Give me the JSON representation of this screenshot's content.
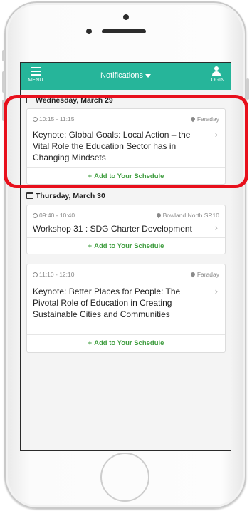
{
  "navbar": {
    "menu_label": "MENU",
    "title": "Notifications",
    "login_label": "LOGIN",
    "background": "#26b59a"
  },
  "days": [
    {
      "date": "Wednesday, March 29",
      "events": [
        {
          "time": "10:15 - 11:15",
          "location": "Faraday",
          "title": "Keynote: Global Goals: Local Action – the Vital Role the Education Sector has in Changing Mindsets",
          "add_label": "Add to Your Schedule"
        }
      ]
    },
    {
      "date": "Thursday, March 30",
      "events": [
        {
          "time": "09:40 - 10:40",
          "location": "Bowland North SR10",
          "title": "Workshop 31 : SDG Charter Development",
          "add_label": "Add to Your Schedule"
        },
        {
          "time": "11:10 - 12:10",
          "location": "Faraday",
          "title": "Keynote: Better Places for People: The Pivotal Role of Education in Creating Sustainable Cities and Communities",
          "add_label": "Add to Your Schedule"
        }
      ]
    }
  ],
  "colors": {
    "accent": "#26b59a",
    "add_green": "#3f9d3f",
    "highlight_red": "#e8101c"
  }
}
